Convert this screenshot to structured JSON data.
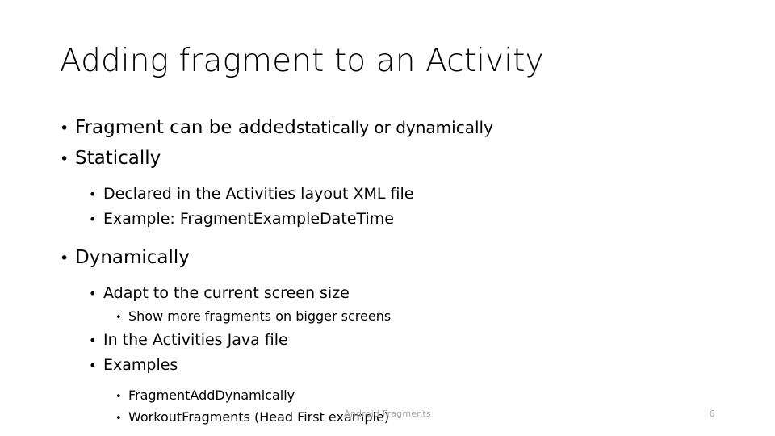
{
  "slide": {
    "title": "Adding fragment to an Activity",
    "background_color": "#ffffff",
    "text_color": "#000000",
    "footer_color": "#a6a6a6",
    "bullet_glyph": "•",
    "content": [
      {
        "level": 1,
        "text": "Fragment can be added ",
        "text_tail": "statically or dynamically"
      },
      {
        "level": 1,
        "text": "Statically"
      },
      {
        "level": 2,
        "text": "Declared in the Activities layout XML file"
      },
      {
        "level": 2,
        "text": "Example: FragmentExampleDateTime"
      },
      {
        "level": 1,
        "text": "Dynamically"
      },
      {
        "level": 2,
        "text": "Adapt to the current screen size"
      },
      {
        "level": 3,
        "text": "Show more fragments on bigger screens"
      },
      {
        "level": 2,
        "text": "In the Activities Java file"
      },
      {
        "level": 2,
        "text": "Examples"
      },
      {
        "level": 3,
        "text": "FragmentAddDynamically"
      },
      {
        "level": 3,
        "text": "WorkoutFragments (Head First example)"
      }
    ],
    "footer": {
      "center_text": "Android Fragments",
      "page_number": "6"
    }
  }
}
